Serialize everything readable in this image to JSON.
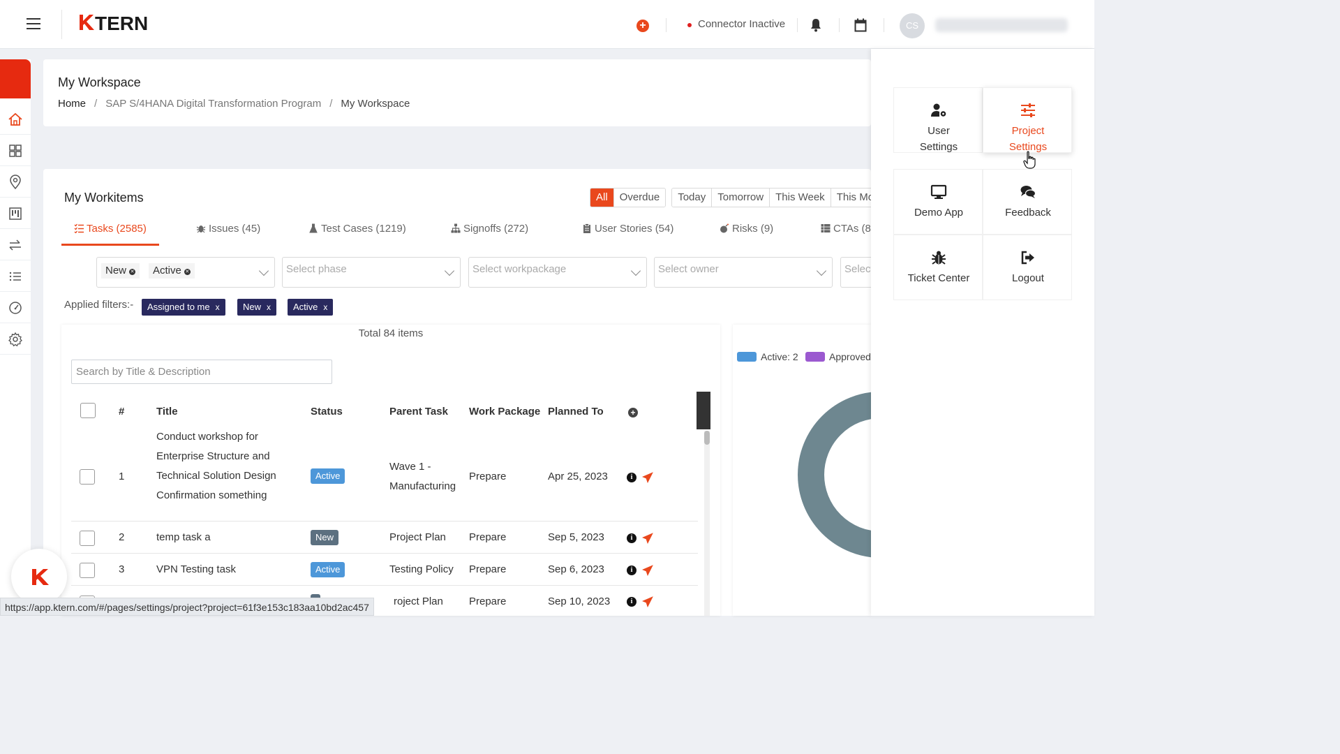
{
  "header": {
    "logo_text": "KTERN",
    "connector_status": "Connector Inactive",
    "avatar_initials": "CS",
    "accent_color": "#e9481d"
  },
  "workspace": {
    "title": "My Workspace",
    "breadcrumb": [
      "Home",
      "SAP S/4HANA Digital Transformation Program",
      "My Workspace"
    ]
  },
  "workitems": {
    "title": "My Workitems",
    "date_filters_group1": [
      "All",
      "Overdue"
    ],
    "date_filters_group2": [
      "Today",
      "Tomorrow",
      "This Week",
      "This Mo"
    ],
    "active_date_filter": "All",
    "tabs": [
      {
        "label": "Tasks (2585)",
        "icon": "list-icon"
      },
      {
        "label": "Issues (45)",
        "icon": "bug-icon"
      },
      {
        "label": "Test Cases (1219)",
        "icon": "flask-icon"
      },
      {
        "label": "Signoffs (272)",
        "icon": "sitemap-icon"
      },
      {
        "label": "User Stories (54)",
        "icon": "clipboard-icon"
      },
      {
        "label": "Risks (9)",
        "icon": "bomb-icon"
      },
      {
        "label": "CTAs (8",
        "icon": "table-icon"
      }
    ],
    "status_chips": [
      "New",
      "Active"
    ],
    "selects": {
      "phase": "Select phase",
      "workpackage": "Select workpackage",
      "owner": "Select owner",
      "extra": "Select"
    },
    "applied_label": "Applied filters:-",
    "applied_filters": [
      "Assigned to me",
      "New",
      "Active"
    ],
    "total": "Total 84 items",
    "search_placeholder": "Search by Title & Description",
    "columns": [
      "#",
      "Title",
      "Status",
      "Parent Task",
      "Work Package",
      "Planned To"
    ],
    "rows": [
      {
        "num": "1",
        "title": [
          "Conduct workshop for",
          "Enterprise Structure and",
          "Technical Solution Design",
          "Confirmation something"
        ],
        "status": "Active",
        "parent": [
          "Wave 1 -",
          "Manufacturing"
        ],
        "package": "Prepare",
        "planned": "Apr 25, 2023"
      },
      {
        "num": "2",
        "title": [
          "temp task a"
        ],
        "status": "New",
        "parent": [
          "Project Plan"
        ],
        "package": "Prepare",
        "planned": "Sep 5, 2023"
      },
      {
        "num": "3",
        "title": [
          "VPN Testing task"
        ],
        "status": "Active",
        "parent": [
          "Testing Policy"
        ],
        "package": "Prepare",
        "planned": "Sep 6, 2023"
      },
      {
        "num": "",
        "title": [
          ""
        ],
        "status": "",
        "parent": [
          "roject Plan"
        ],
        "package": "Prepare",
        "planned": "Sep 10, 2023"
      }
    ]
  },
  "chart_data": {
    "type": "pie",
    "legend": [
      {
        "label": "Active: 2",
        "color": "#4d97d9"
      },
      {
        "label": "Approved",
        "color": "#9b59d0"
      }
    ],
    "ring_color": "#6e8790"
  },
  "menu": {
    "items": [
      {
        "label": [
          "User",
          "Settings"
        ],
        "icon": "user-gear-icon"
      },
      {
        "label": [
          "Project",
          "Settings"
        ],
        "icon": "sliders-icon",
        "selected": true
      },
      {
        "label": [
          "Demo App"
        ],
        "icon": "desktop-icon"
      },
      {
        "label": [
          "Feedback"
        ],
        "icon": "comments-icon"
      },
      {
        "label": [
          "Ticket Center"
        ],
        "icon": "bug-icon"
      },
      {
        "label": [
          "Logout"
        ],
        "icon": "logout-icon"
      }
    ]
  },
  "status_url": "https://app.ktern.com/#/pages/settings/project?project=61f3e153c183aa10bd2ac457"
}
